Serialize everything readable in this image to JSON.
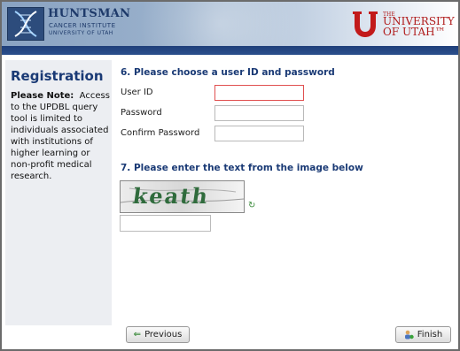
{
  "header": {
    "left_logo": {
      "name": "HUNTSMAN",
      "sub1": "CANCER INSTITUTE",
      "sub2": "UNIVERSITY OF UTAH"
    },
    "right_logo": {
      "the": "THE",
      "line1": "UNIVERSITY",
      "line2": "OF UTAH™"
    }
  },
  "sidebar": {
    "title": "Registration",
    "note_label": "Please Note:",
    "note_text": "Access to the UPDBL query tool  is limited to individuals associated with institutions of higher learning or non-profit medical research."
  },
  "step6": {
    "heading": "6. Please choose a user ID and password",
    "user_id_label": "User ID",
    "password_label": "Password",
    "confirm_label": "Confirm Password"
  },
  "step7": {
    "heading": "7. Please enter the text from the image below",
    "captcha_text": "keath"
  },
  "buttons": {
    "previous": "Previous",
    "finish": "Finish"
  },
  "colors": {
    "heading": "#1a3a75",
    "error_border": "#e05050"
  }
}
